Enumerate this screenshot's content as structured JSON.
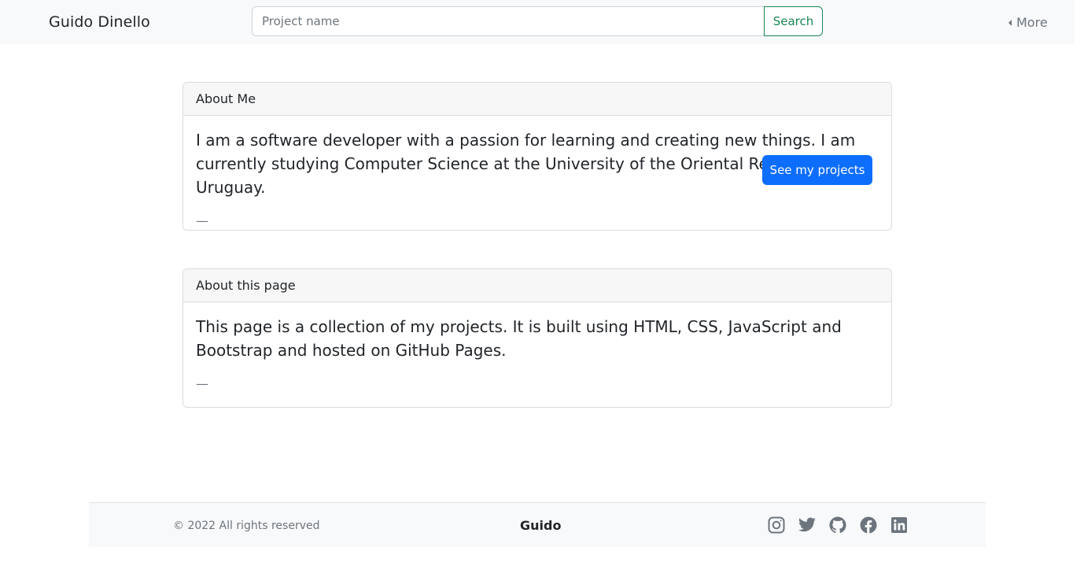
{
  "navbar": {
    "brand": "Guido Dinello",
    "search_placeholder": "Project name",
    "search_label": "Search",
    "more_label": "More"
  },
  "cards": [
    {
      "title": "About Me",
      "text": "I am a software developer with a passion for learning and creating new things. I am currently studying Computer Science at the University of the Oriental Republic of Uruguay.",
      "footer": "—",
      "button_label": "See my projects"
    },
    {
      "title": "About this page",
      "text": "This page is a collection of my projects. It is built using HTML, CSS, JavaScript and Bootstrap and hosted on GitHub Pages.",
      "footer": "—"
    }
  ],
  "footer": {
    "copyright": "© 2022 All rights reserved",
    "name": "Guido",
    "socials": [
      "instagram-icon",
      "twitter-icon",
      "github-icon",
      "facebook-icon",
      "linkedin-icon"
    ]
  },
  "colors": {
    "primary": "#0d6efd",
    "success": "#198754",
    "navbar_bg": "#f8f9fa",
    "icon_gray": "#6c757d"
  }
}
